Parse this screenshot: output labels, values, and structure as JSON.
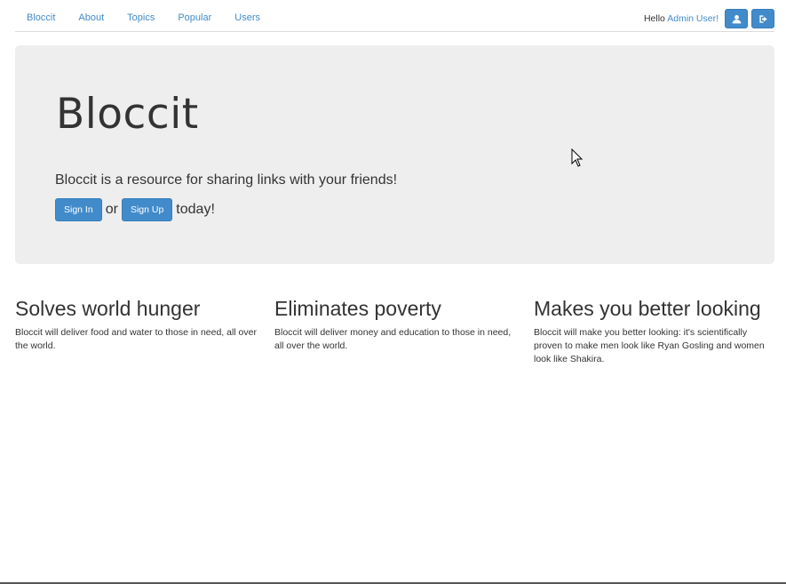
{
  "nav": {
    "links": [
      "Bloccit",
      "About",
      "Topics",
      "Popular",
      "Users"
    ],
    "hello": "Hello",
    "user": "Admin User!"
  },
  "jumbotron": {
    "title": "Bloccit",
    "tagline": "Bloccit is a resource for sharing links with your friends!",
    "sign_in": "Sign In",
    "or": "or",
    "sign_up": "Sign Up",
    "today": "today!"
  },
  "features": [
    {
      "title": "Solves world hunger",
      "text": "Bloccit will deliver food and water to those in need, all over the world."
    },
    {
      "title": "Eliminates poverty",
      "text": "Bloccit will deliver money and education to those in need, all over the world."
    },
    {
      "title": "Makes you better looking",
      "text": "Bloccit will make you better looking: it's scientifically proven to make men look like Ryan Gosling and women look like Shakira."
    }
  ],
  "icons": {
    "profile": "user-icon",
    "signout": "sign-out-icon"
  },
  "colors": {
    "accent": "#428bca",
    "jumbotron_bg": "#eeeeee"
  }
}
